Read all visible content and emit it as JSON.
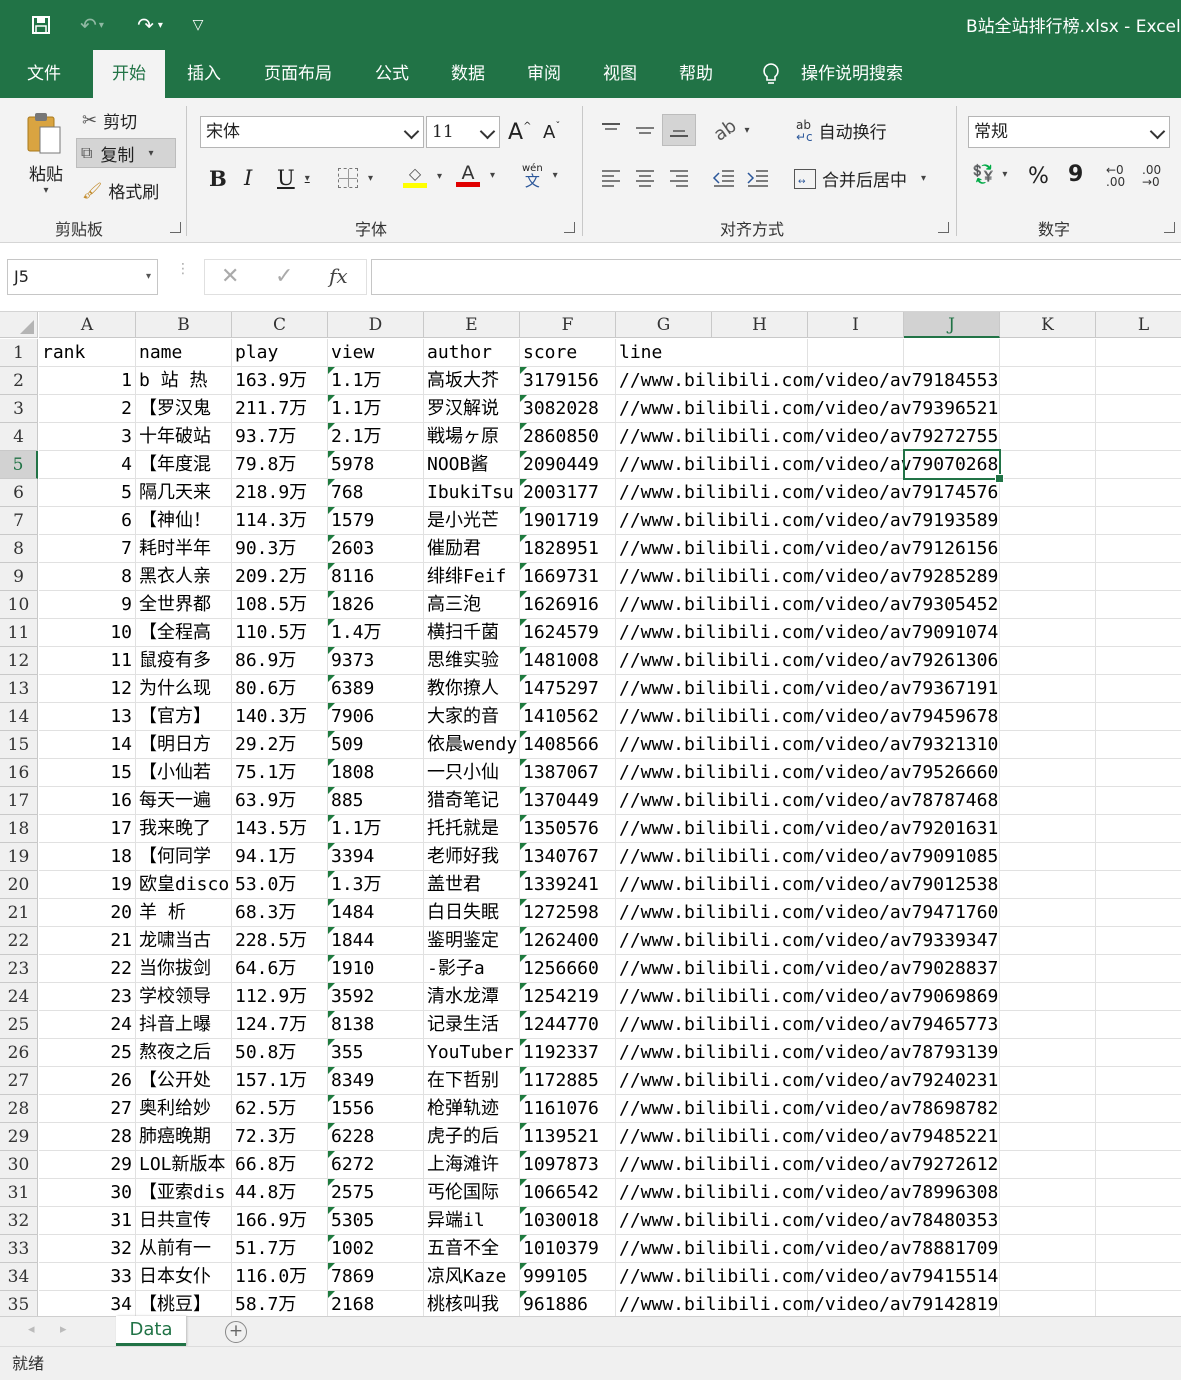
{
  "window": {
    "title": "B站全站排行榜.xlsx  -  Excel"
  },
  "menu": {
    "tabs": [
      "文件",
      "开始",
      "插入",
      "页面布局",
      "公式",
      "数据",
      "审阅",
      "视图",
      "帮助"
    ],
    "active": "开始",
    "search": "操作说明搜索"
  },
  "ribbon": {
    "clipboard": {
      "paste": "粘贴",
      "cut": "剪切",
      "copy": "复制",
      "format_painter": "格式刷",
      "label": "剪贴板"
    },
    "font": {
      "name": "宋体",
      "size": "11",
      "label": "字体",
      "bold": "B",
      "italic": "I",
      "underline": "U",
      "phonetic": "wén\n文",
      "grow": "A",
      "shrink": "A"
    },
    "alignment": {
      "wrap_text": "自动换行",
      "merge_center": "合并后居中",
      "label": "对齐方式"
    },
    "number": {
      "format": "常规",
      "label": "数字",
      "percent": "%",
      "comma": "9",
      "inc_decimal": "←0\n.00",
      "dec_decimal": ".00\n→0"
    }
  },
  "formula_bar": {
    "name_box": "J5",
    "fx": "fx",
    "content": ""
  },
  "columns": [
    "A",
    "B",
    "C",
    "D",
    "E",
    "F",
    "G",
    "H",
    "I",
    "J",
    "K",
    "L"
  ],
  "selected_column": "J",
  "selected_row": 5,
  "table": {
    "headers": [
      "rank",
      "name",
      "play",
      "view",
      "author",
      "score",
      "line"
    ],
    "rows": [
      [
        "1",
        "b 站 热",
        "163.9万",
        "1.1万",
        "高坂大芥",
        "3179156",
        "//www.bilibili.com/video/av79184553"
      ],
      [
        "2",
        "【罗汉鬼",
        "211.7万",
        "1.1万",
        "罗汉解说",
        "3082028",
        "//www.bilibili.com/video/av79396521"
      ],
      [
        "3",
        "十年破站",
        "93.7万",
        "2.1万",
        "戦場ヶ原",
        "2860850",
        "//www.bilibili.com/video/av79272755"
      ],
      [
        "4",
        "【年度混",
        "79.8万",
        "5978",
        "NOOB酱",
        "2090449",
        "//www.bilibili.com/video/av79070268"
      ],
      [
        "5",
        "隔几天来",
        "218.9万",
        "768",
        "IbukiTsu",
        "2003177",
        "//www.bilibili.com/video/av79174576"
      ],
      [
        "6",
        "【神仙！",
        "114.3万",
        "1579",
        "是小光芒",
        "1901719",
        "//www.bilibili.com/video/av79193589"
      ],
      [
        "7",
        "耗时半年",
        "90.3万",
        "2603",
        "催励君",
        "1828951",
        "//www.bilibili.com/video/av79126156"
      ],
      [
        "8",
        "黑衣人亲",
        "209.2万",
        "8116",
        "绯绯Feif",
        "1669731",
        "//www.bilibili.com/video/av79285289"
      ],
      [
        "9",
        "全世界都",
        "108.5万",
        "1826",
        "高三泡",
        "1626916",
        "//www.bilibili.com/video/av79305452"
      ],
      [
        "10",
        "【全程高",
        "110.5万",
        "1.4万",
        "横扫千菌",
        "1624579",
        "//www.bilibili.com/video/av79091074"
      ],
      [
        "11",
        "鼠疫有多",
        "86.9万",
        "9373",
        "思维实验",
        "1481008",
        "//www.bilibili.com/video/av79261306"
      ],
      [
        "12",
        "为什么现",
        "80.6万",
        "6389",
        "教你撩人",
        "1475297",
        "//www.bilibili.com/video/av79367191"
      ],
      [
        "13",
        "【官方】",
        "140.3万",
        "7906",
        "大家的音",
        "1410562",
        "//www.bilibili.com/video/av79459678"
      ],
      [
        "14",
        "【明日方",
        "29.2万",
        "509",
        "依晨wendy",
        "1408566",
        "//www.bilibili.com/video/av79321310"
      ],
      [
        "15",
        "【小仙若",
        "75.1万",
        "1808",
        "一只小仙",
        "1387067",
        "//www.bilibili.com/video/av79526660"
      ],
      [
        "16",
        "每天一遍",
        "63.9万",
        "885",
        "猎奇笔记",
        "1370449",
        "//www.bilibili.com/video/av78787468"
      ],
      [
        "17",
        "我来晚了",
        "143.5万",
        "1.1万",
        "托托就是",
        "1350576",
        "//www.bilibili.com/video/av79201631"
      ],
      [
        "18",
        "【何同学",
        "94.1万",
        "3394",
        "老师好我",
        "1340767",
        "//www.bilibili.com/video/av79091085"
      ],
      [
        "19",
        "欧皇disco",
        "53.0万",
        "1.3万",
        "盖世君",
        "1339241",
        "//www.bilibili.com/video/av79012538"
      ],
      [
        "20",
        "羊    析",
        "68.3万",
        "1484",
        "白日失眠",
        "1272598",
        "//www.bilibili.com/video/av79471760"
      ],
      [
        "21",
        "龙啸当古",
        "228.5万",
        "1844",
        "鉴明鉴定",
        "1262400",
        "//www.bilibili.com/video/av79339347"
      ],
      [
        "22",
        "当你拔剑",
        "64.6万",
        "1910",
        "-影子a",
        "1256660",
        "//www.bilibili.com/video/av79028837"
      ],
      [
        "23",
        "学校领导",
        "112.9万",
        "3592",
        "清水龙潭",
        "1254219",
        "//www.bilibili.com/video/av79069869"
      ],
      [
        "24",
        "抖音上曝",
        "124.7万",
        "8138",
        "记录生活",
        "1244770",
        "//www.bilibili.com/video/av79465773"
      ],
      [
        "25",
        "熬夜之后",
        "50.8万",
        "355",
        "YouTuber",
        "1192337",
        "//www.bilibili.com/video/av78793139"
      ],
      [
        "26",
        "【公开处",
        "157.1万",
        "8349",
        "在下哲别",
        "1172885",
        "//www.bilibili.com/video/av79240231"
      ],
      [
        "27",
        "奥利给妙",
        "62.5万",
        "1556",
        "枪弹轨迹",
        "1161076",
        "//www.bilibili.com/video/av78698782"
      ],
      [
        "28",
        "肺癌晚期",
        "72.3万",
        "6228",
        "虎子的后",
        "1139521",
        "//www.bilibili.com/video/av79485221"
      ],
      [
        "29",
        "LOL新版本",
        "66.8万",
        "6272",
        "上海滩许",
        "1097873",
        "//www.bilibili.com/video/av79272612"
      ],
      [
        "30",
        "【亚索dis",
        "44.8万",
        "2575",
        "丐伦国际",
        "1066542",
        "//www.bilibili.com/video/av78996308"
      ],
      [
        "31",
        "日共宣传",
        "166.9万",
        "5305",
        "异端il",
        "1030018",
        "//www.bilibili.com/video/av78480353"
      ],
      [
        "32",
        "从前有一",
        "51.7万",
        "1002",
        "五音不全",
        "1010379",
        "//www.bilibili.com/video/av78881709"
      ],
      [
        "33",
        "日本女仆",
        "116.0万",
        "7869",
        "凉风Kaze",
        "999105",
        "//www.bilibili.com/video/av79415514"
      ],
      [
        "34",
        "【桃豆】",
        "58.7万",
        "2168",
        "桃核叫我",
        "961886",
        "//www.bilibili.com/video/av79142819"
      ]
    ]
  },
  "sheet_tabs": [
    "Data"
  ],
  "status": {
    "text": "就绪"
  },
  "colors": {
    "accent": "#217346",
    "num_triangle": "#1e7a3e"
  }
}
